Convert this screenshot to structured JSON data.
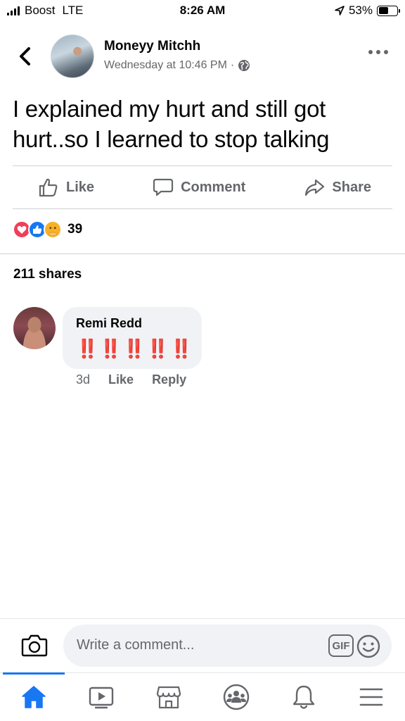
{
  "status_bar": {
    "carrier": "Boost",
    "network": "LTE",
    "time": "8:26 AM",
    "battery_percent": "53%",
    "battery_level": 0.53
  },
  "post": {
    "author": "Moneyy Mitchh",
    "timestamp": "Wednesday at 10:46 PM",
    "separator": "·",
    "privacy_icon": "globe-icon",
    "text": "I explained my hurt and still got hurt..so I learned to stop talking"
  },
  "actions": {
    "like_label": "Like",
    "comment_label": "Comment",
    "share_label": "Share"
  },
  "reactions": {
    "icons": [
      "love-reaction-icon",
      "like-reaction-icon",
      "care-reaction-icon"
    ],
    "count": "39"
  },
  "shares_text": "211 shares",
  "comments": [
    {
      "author": "Remi Redd",
      "text": "‼️‼️‼️‼️‼️",
      "age": "3d",
      "like_label": "Like",
      "reply_label": "Reply"
    }
  ],
  "composer": {
    "placeholder": "Write a comment...",
    "gif_label": "GIF"
  },
  "bottom_nav": {
    "items": [
      "home-icon",
      "watch-icon",
      "marketplace-icon",
      "groups-icon",
      "notifications-icon",
      "menu-icon"
    ],
    "active": "home-icon"
  },
  "colors": {
    "accent": "#1877f2",
    "text_secondary": "#65676b",
    "bubble_bg": "#f0f2f5",
    "exclamation_red": "#d9221c"
  }
}
